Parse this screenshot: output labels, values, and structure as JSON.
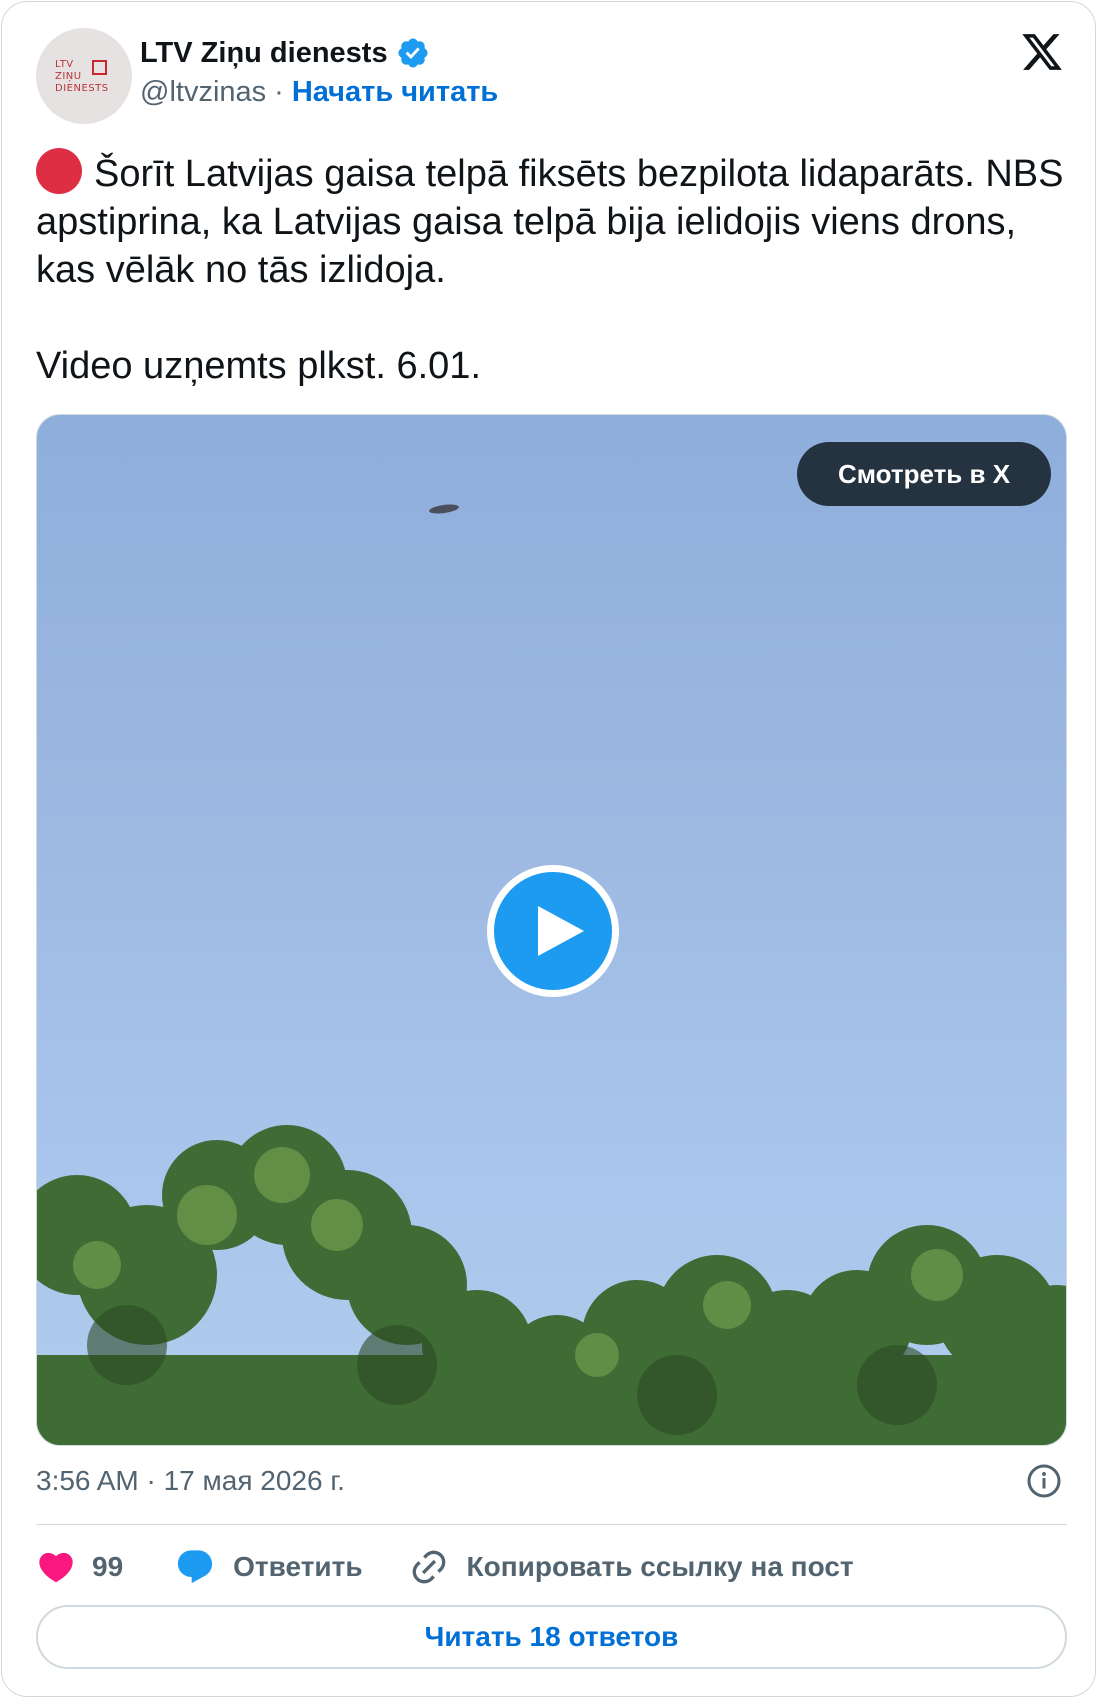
{
  "author": {
    "display_name": "LTV Ziņu dienests",
    "handle": "@ltvzinas",
    "separator": "·",
    "follow_label": "Начать читать",
    "avatar_text": "LTV\nZIŅU\nDIENESTS",
    "verified": true
  },
  "tweet": {
    "paragraph_1": "Šorīt Latvijas gaisa telpā fiksēts bezpilota lidaparāts. NBS apstiprina, ka Latvijas gaisa telpā bija ielidojis viens drons, kas vēlāk no tās izlidoja.",
    "paragraph_2": "Video uzņemts plkst. 6.01.",
    "leading_emoji": "red-circle"
  },
  "media": {
    "watch_label": "Смотреть в X",
    "play_icon": "play-icon"
  },
  "meta": {
    "timestamp": "3:56 AM · 17 мая 2026 г."
  },
  "actions": {
    "like_count": "99",
    "reply_label": "Ответить",
    "copy_link_label": "Копировать ссылку на пост"
  },
  "read_replies_label": "Читать 18 ответов",
  "colors": {
    "accent": "#1d9bf0",
    "link": "#006fd6",
    "like": "#f91880",
    "secondary_text": "#536471",
    "border": "#cfd9de",
    "watch_button": "#253340"
  }
}
